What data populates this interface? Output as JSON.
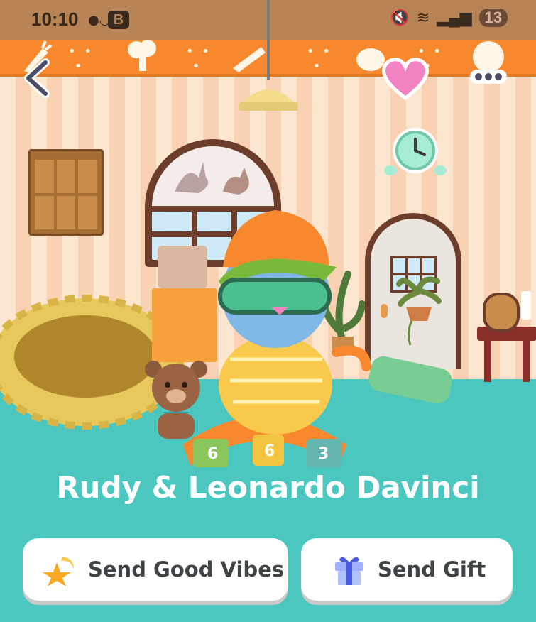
{
  "status_bar": {
    "time": "10:10",
    "badge": "B",
    "battery": "13"
  },
  "room": {
    "pet_names": "Rudy & Leonardo Davinci"
  },
  "actions": {
    "send_good_vibes_label": "Send Good Vibes",
    "send_gift_label": "Send Gift"
  },
  "colors": {
    "floor": "#4bc7c0",
    "trim": "#f7882e",
    "heart": "#f283c3",
    "button_text": "#3e4346"
  },
  "icons": [
    "back-arrow-icon",
    "heart-icon",
    "more-icon",
    "alarm-clock-icon",
    "star-icon",
    "gift-icon"
  ]
}
